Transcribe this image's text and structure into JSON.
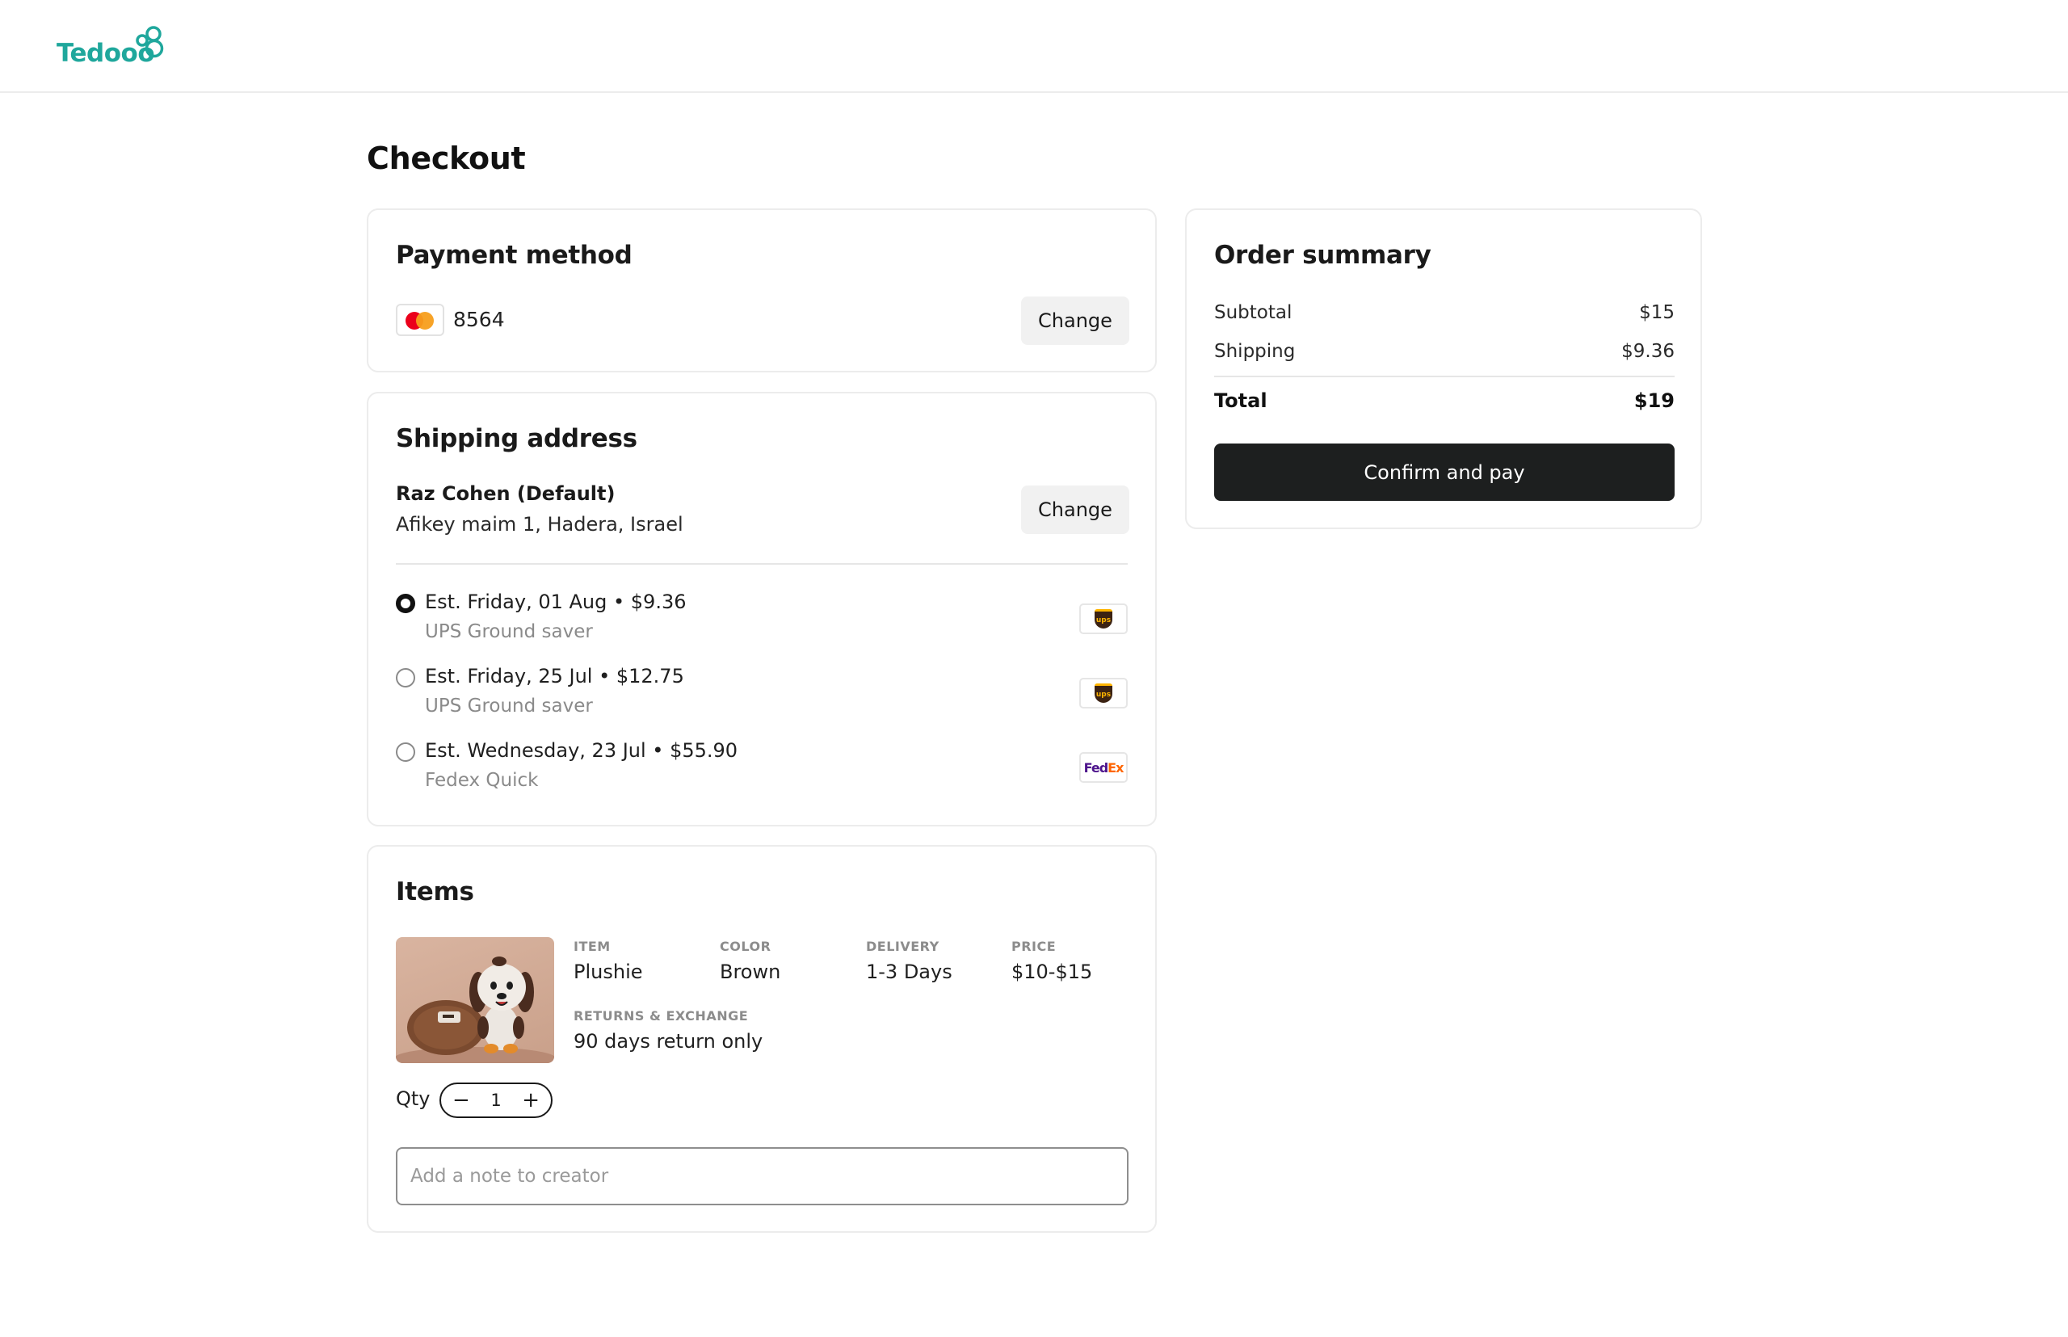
{
  "header": {
    "logo_text": "Tedooo",
    "brand_color": "#1fa79c"
  },
  "page": {
    "title": "Checkout"
  },
  "payment": {
    "title": "Payment method",
    "card_icon": "mastercard-icon",
    "last4": "8564",
    "change_label": "Change"
  },
  "shipping": {
    "title": "Shipping address",
    "name": "Raz Cohen (Default)",
    "address": "Afikey maim 1, Hadera, Israel",
    "change_label": "Change",
    "options": [
      {
        "title": "Est. Friday, 01 Aug • $9.36",
        "carrier": "UPS Ground saver",
        "logo": "ups-logo",
        "selected": true
      },
      {
        "title": "Est. Friday, 25 Jul • $12.75",
        "carrier": "UPS Ground saver",
        "logo": "ups-logo",
        "selected": false
      },
      {
        "title": "Est. Wednesday, 23 Jul • $55.90",
        "carrier": "Fedex Quick",
        "logo": "fedex-logo",
        "selected": false
      }
    ],
    "ups_mark": "ups",
    "fedex_mark_fe": "Fed",
    "fedex_mark_ex": "Ex"
  },
  "items": {
    "title": "Items",
    "list": [
      {
        "image": "plushie-photo",
        "item_label": "ITEM",
        "item_value": "Plushie",
        "color_label": "COLOR",
        "color_value": "Brown",
        "delivery_label": "DELIVERY",
        "delivery_value": "1-3 Days",
        "price_label": "PRICE",
        "price_value": "$10-$15",
        "returns_label": "RETURNS & EXCHANGE",
        "returns_value": "90 days return only",
        "qty_label": "Qty",
        "qty": "1",
        "minus": "−",
        "plus": "+"
      }
    ],
    "note_placeholder": "Add a note to creator"
  },
  "summary": {
    "title": "Order summary",
    "subtotal_label": "Subtotal",
    "subtotal_value": "$15",
    "shipping_label": "Shipping",
    "shipping_value": "$9.36",
    "total_label": "Total",
    "total_value": "$19",
    "confirm_label": "Confirm and pay"
  }
}
